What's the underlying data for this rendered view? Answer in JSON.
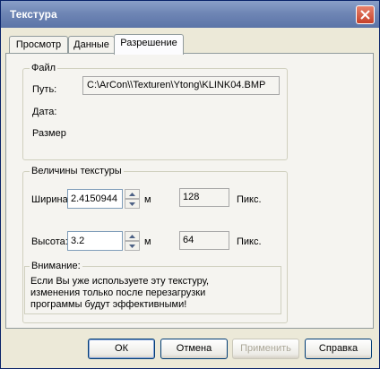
{
  "window": {
    "title": "Текстура"
  },
  "tabs": [
    {
      "label": "Просмотр"
    },
    {
      "label": "Данные"
    },
    {
      "label": "Разрешение"
    }
  ],
  "file_group": {
    "legend": "Файл",
    "path_label": "Путь:",
    "path_value": "C:\\ArCon\\\\Texturen\\Ytong\\KLINK04.BMP",
    "date_label": "Дата:",
    "size_label": "Размер"
  },
  "texture_group": {
    "legend": "Величины текстуры",
    "width_label": "Ширина:",
    "width_value": "2.4150944",
    "width_unit": "м",
    "width_px": "128",
    "width_px_unit": "Пикс.",
    "height_label": "Высота:",
    "height_value": "3.2",
    "height_unit": "м",
    "height_px": "64",
    "height_px_unit": "Пикс."
  },
  "warning": {
    "legend": "Внимание:",
    "line1": "Если Вы уже используете эту текстуру,",
    "line2": "изменения только после перезагрузки",
    "line3": "программы будут эффективными!"
  },
  "buttons": {
    "ok": "ОК",
    "cancel": "Отмена",
    "apply": "Применить",
    "help": "Справка"
  }
}
